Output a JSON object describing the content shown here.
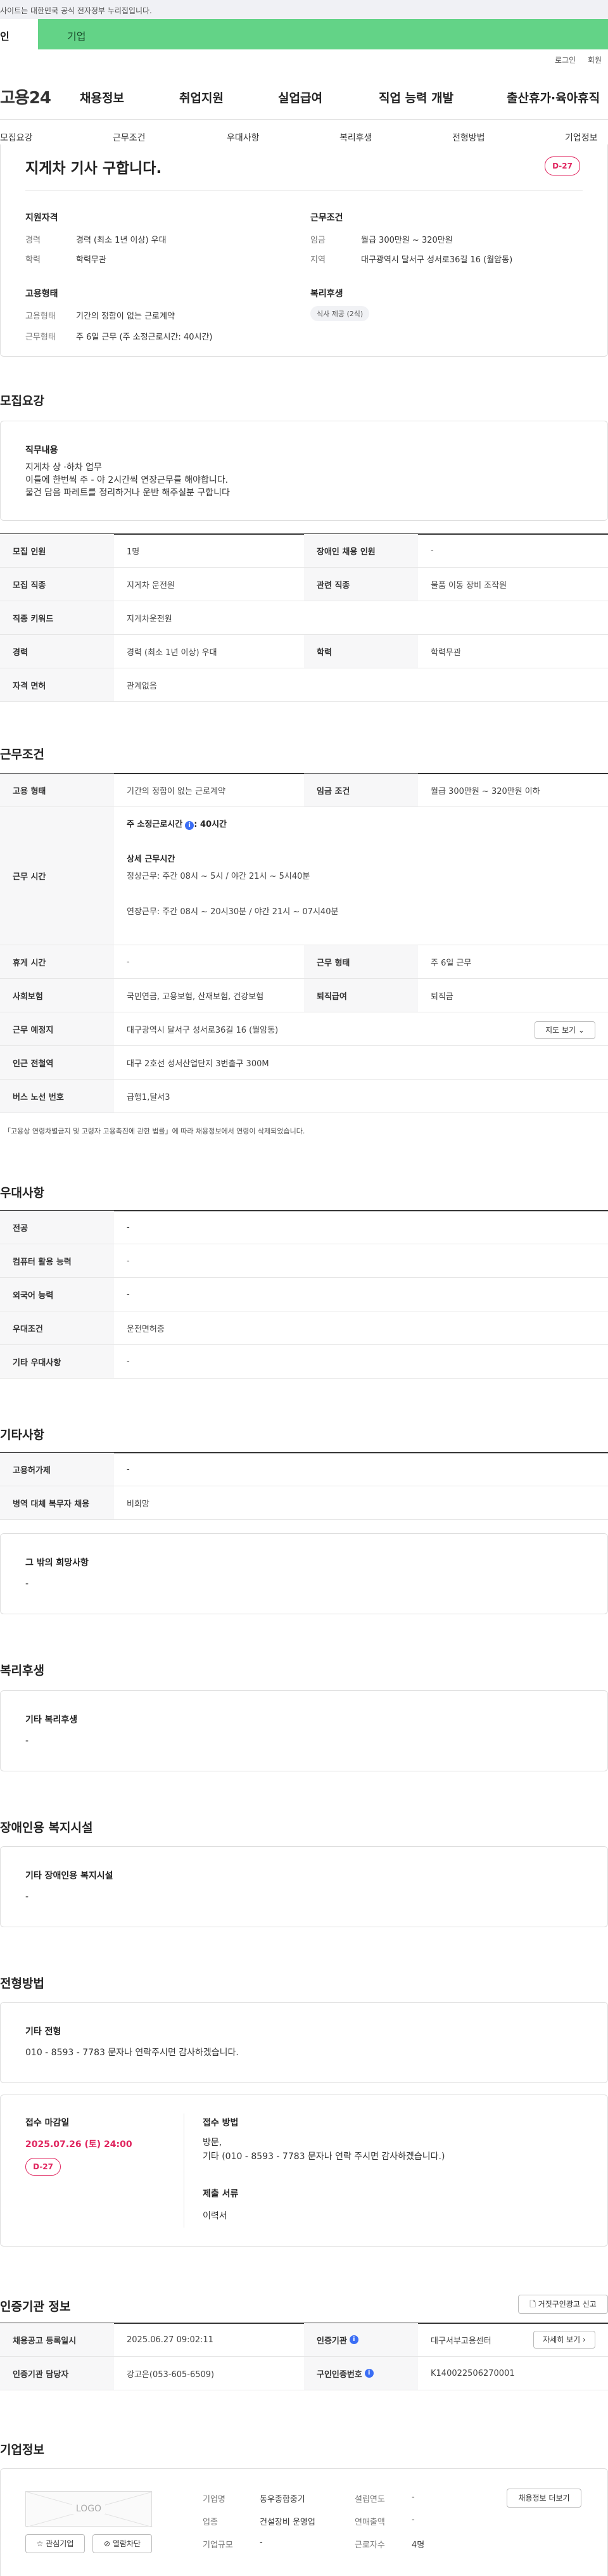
{
  "top_notice": "사이트는 대한민국 공식 전자정부 누리집입니다.",
  "user_tabs": {
    "personal": "인",
    "business": "기업"
  },
  "util": {
    "login": "로그인",
    "signup": "회원"
  },
  "logo": "고용24",
  "gnb": [
    "채용정보",
    "취업지원",
    "실업급여",
    "직업 능력 개발",
    "출산휴가·육아휴직"
  ],
  "subnav": [
    "모집요강",
    "근무조건",
    "우대사항",
    "복리후생",
    "전형방법",
    "기업정보"
  ],
  "summary": {
    "title": "지게차 기사 구합니다.",
    "dday": "D-27",
    "qual_label": "지원자격",
    "cond_label": "근무조건",
    "emp_label": "고용형태",
    "welfare_label": "복리후생",
    "career_k": "경력",
    "career_v": "경력 (최소 1년 이상) 우대",
    "edu_k": "학력",
    "edu_v": "학력무관",
    "wage_k": "임금",
    "wage_v": "월급 300만원 ~ 320만원",
    "region_k": "지역",
    "region_v": "대구광역시 달서구 성서로36길 16 (월암동)",
    "emptype_k": "고용형태",
    "emptype_v": "기간의 정함이 없는 근로계약",
    "worktype_k": "근무형태",
    "worktype_v": "주 6일 근무 (주 소정근로시간: 40시간)",
    "welfare_chip": "식사 제공 (2식)"
  },
  "recruit": {
    "title": "모집요강",
    "duty_label": "직무내용",
    "duty_lines": [
      "지게차  상 ·하차 업무",
      "이틀에 한번씩 주 - 야 2시간씩 연장근무를 해야합니다.",
      "물건 담음 파레트를 정리하거나 운반 해주실분 구합니다"
    ],
    "rows": [
      {
        "k1": "모집 인원",
        "v1": "1명",
        "k2": "장애인 채용 인원",
        "v2": "-"
      },
      {
        "k1": "모집 직종",
        "v1": "지게차 운전원",
        "k2": "관련 직종",
        "v2": "물품 이동 장비 조작원"
      },
      {
        "k1": "직종 키워드",
        "v1": "지게차운전원"
      },
      {
        "k1": "경력",
        "v1": "경력 (최소 1년 이상) 우대",
        "k2": "학력",
        "v2": "학력무관"
      },
      {
        "k1": "자격 면허",
        "v1": "관계없음"
      }
    ]
  },
  "cond": {
    "title": "근무조건",
    "emptype_k": "고용 형태",
    "emptype_v": "기간의 정함이 없는 근로계약",
    "wage_k": "임금 조건",
    "wage_v": "월급 300만원 ~ 320만원 이하",
    "time_k": "근무 시간",
    "time_main": "주 소정근로시간",
    "time_main_v": ": 40시간",
    "time_detail_label": "상세 근무시간",
    "time_line1": "정상근무: 주간 08시 ~ 5시 / 야간 21시 ~ 5시40분",
    "time_line2": "연장근무: 주간 08시 ~ 20시30분 / 야간 21시 ~ 07시40분",
    "break_k": "휴게 시간",
    "break_v": "-",
    "worktype_k": "근무 형태",
    "worktype_v": "주 6일 근무",
    "insure_k": "사회보험",
    "insure_v": "국민연금, 고용보험, 산재보험, 건강보험",
    "retire_k": "퇴직급여",
    "retire_v": "퇴직금",
    "place_k": "근무 예정지",
    "place_v": "대구광역시 달서구 성서로36길 16 (월암동)",
    "map_btn": "지도 보기",
    "station_k": "인근 전철역",
    "station_v": "대구 2호선 성서산업단지 3번출구 300M",
    "bus_k": "버스 노선 번호",
    "bus_v": "급행1,달서3",
    "note": "「고용상 연령차별금지 및 고령자 고용촉진에 관한 법률」에 따라 채용정보에서 연령이 삭제되었습니다."
  },
  "pref": {
    "title": "우대사항",
    "rows": [
      {
        "k": "전공",
        "v": "-"
      },
      {
        "k": "컴퓨터 활용 능력",
        "v": "-"
      },
      {
        "k": "외국어 능력",
        "v": "-"
      },
      {
        "k": "우대조건",
        "v": "운전면허증"
      },
      {
        "k": "기타 우대사항",
        "v": "-"
      }
    ]
  },
  "etc": {
    "title": "기타사항",
    "rows": [
      {
        "k": "고용허가제",
        "v": "-"
      },
      {
        "k": "병역 대체 복무자 채용",
        "v": "비희망"
      }
    ],
    "hope_label": "그 밖의 희망사항",
    "hope_v": "-"
  },
  "welfare": {
    "title": "복리후생",
    "label": "기타 복리후생",
    "v": "-"
  },
  "disabled": {
    "title": "장애인용 복지시설",
    "label": "기타 장애인용 복지시설",
    "v": "-"
  },
  "selection": {
    "title": "전형방법",
    "etc_label": "기타 전형",
    "etc_v": "010 - 8593 - 7783 문자나 연락주시면 감사하겠습니다.",
    "deadline_label": "접수 마감일",
    "deadline_v": "2025.07.26 (토) 24:00",
    "dday": "D-27",
    "method_label": "접수 방법",
    "method_v1": "방문,",
    "method_v2": "기타 (010 - 8593 - 7783 문자나  연락 주시면 감사하겠습니다.)",
    "docs_label": "제출 서류",
    "docs_v": "이력서"
  },
  "auth": {
    "title": "인증기관 정보",
    "report_btn": "거짓구인광고 신고",
    "reg_k": "채용공고 등록일시",
    "reg_v": "2025.06.27 09:02:11",
    "org_k": "인증기관",
    "org_v": "대구서부고용센터",
    "more_btn": "자세히 보기",
    "mgr_k": "인증기관 담당자",
    "mgr_v": "강고은(053-605-6509)",
    "no_k": "구인인증번호",
    "no_v": "K140022506270001"
  },
  "company": {
    "title": "기업정보",
    "logo_text": "LOGO",
    "fav_btn": "관심기업",
    "block_btn": "열람차단",
    "name_k": "기업명",
    "name_v": "동우종합중기",
    "found_k": "설립연도",
    "found_v": "-",
    "biz_k": "업종",
    "biz_v": "건설장비 운영업",
    "sales_k": "연매출액",
    "sales_v": "-",
    "size_k": "기업규모",
    "size_v": "-",
    "staff_k": "근로자수",
    "staff_v": "4명",
    "more_btn": "채용정보 더보기"
  }
}
